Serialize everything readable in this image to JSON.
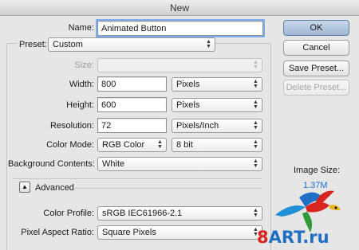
{
  "window": {
    "title": "New"
  },
  "name": {
    "label": "Name:",
    "value": "Animated Button"
  },
  "preset": {
    "label": "Preset:",
    "value": "Custom"
  },
  "size": {
    "label": "Size:",
    "value": ""
  },
  "width": {
    "label": "Width:",
    "value": "800",
    "unit": "Pixels"
  },
  "height": {
    "label": "Height:",
    "value": "600",
    "unit": "Pixels"
  },
  "resolution": {
    "label": "Resolution:",
    "value": "72",
    "unit": "Pixels/Inch"
  },
  "color_mode": {
    "label": "Color Mode:",
    "value": "RGB Color",
    "depth": "8 bit"
  },
  "background_contents": {
    "label": "Background Contents:",
    "value": "White"
  },
  "advanced": {
    "label": "Advanced",
    "icon": "disclosure-up-triangle-icon"
  },
  "color_profile": {
    "label": "Color Profile:",
    "value": "sRGB IEC61966-2.1"
  },
  "pixel_aspect_ratio": {
    "label": "Pixel Aspect Ratio:",
    "value": "Square Pixels"
  },
  "buttons": {
    "ok": "OK",
    "cancel": "Cancel",
    "save_preset": "Save Preset...",
    "delete_preset": "Delete Preset..."
  },
  "image_size": {
    "label": "Image Size:",
    "value": "1.37M"
  },
  "watermark": {
    "logo_icon": "parrot-logo-icon",
    "text": "8ART.ru"
  },
  "colors": {
    "accent_blue": "#1a6fcf",
    "default_button": "#9eb6d4",
    "watermark_red": "#d6261f",
    "watermark_blue": "#1f6fc4"
  }
}
